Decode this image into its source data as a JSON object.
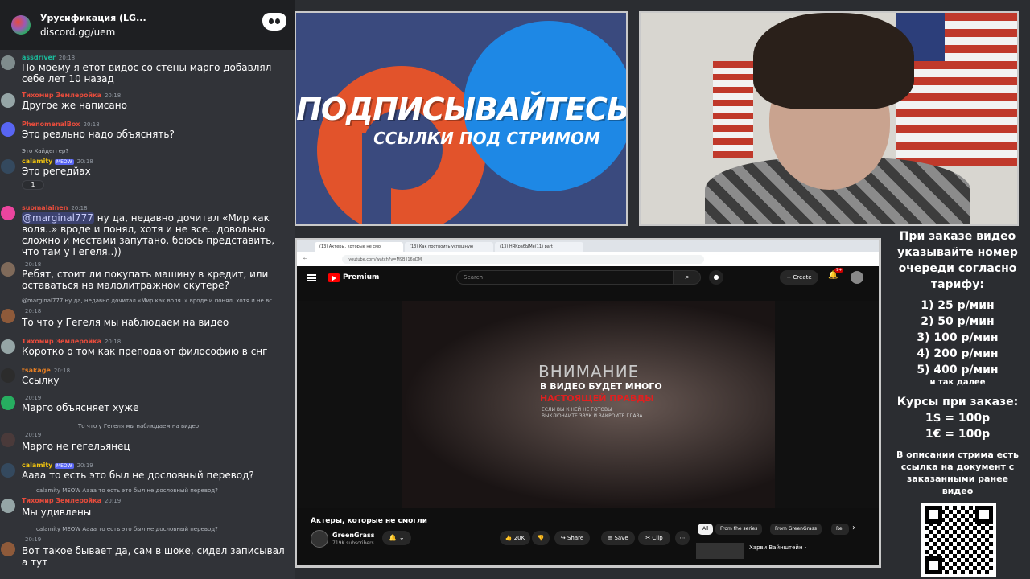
{
  "chat": {
    "server_title": "Урусификация (LG...",
    "invite": "discord.gg/uem",
    "messages": [
      {
        "name": "assdriver",
        "time": "20:18",
        "name_color": "#1abc9c",
        "text": "По-моему я етот видос со стены марго добавлял себе лет 10 назад"
      },
      {
        "name": "Тихомир Землеройка",
        "time": "20:18",
        "name_color": "#e74c3c",
        "text": "Другое же написано"
      },
      {
        "name": "PhenomenalBox",
        "time": "20:18",
        "name_color": "#e74c3c",
        "text": "Это реально надо объяснять?"
      },
      {
        "reply": "Это Хайдеггер?",
        "name": "calamity",
        "badge": "MEOW",
        "time": "20:18",
        "name_color": "#f1c40f",
        "text": "Это регедйах",
        "reaction_count": "1"
      },
      {
        "name": "suomalainen",
        "time": "20:18",
        "name_color": "#e74c3c",
        "mention": "@marginal777",
        "text": " ну да, недавно дочитал «Мир как воля..» вроде и понял, хотя и не все.. довольно сложно и местами запутано, боюсь представить, что там у Гегеля..))"
      },
      {
        "name": "",
        "time": "20:18",
        "name_color": "#e74c3c",
        "text": "Ребят, стоит ли покупать машину в кредит, или оставаться на малолитражном скутере?"
      },
      {
        "reply": "@marginal777 ну да, недавно дочитал «Мир как воля..» вроде и понял, хотя и не вс",
        "name": "",
        "time": "20:18",
        "name_color": "#e74c3c",
        "text": "То что у Гегеля мы наблюдаем на видео"
      },
      {
        "name": "Тихомир Землеройка",
        "time": "20:18",
        "name_color": "#e74c3c",
        "text": "Коротко о том как преподают философию в снг"
      },
      {
        "name": "tsakage",
        "time": "20:18",
        "name_color": "#e67e22",
        "text": "Ссылку"
      },
      {
        "name": "",
        "time": "20:19",
        "name_color": "#9b59b6",
        "text": "Марго объясняет хуже"
      },
      {
        "reply": "То что у Гегеля мы наблюдаем на видео",
        "name": "",
        "time": "20:19",
        "name_color": "#e74c3c",
        "text": "Марго не гегельянец"
      },
      {
        "name": "calamity",
        "badge": "MEOW",
        "time": "20:19",
        "name_color": "#f1c40f",
        "text": "Аааа то есть это был не дословный перевод?"
      },
      {
        "reply": "calamity MEOW Аааа то есть это был не дословный перевод?",
        "name": "Тихомир Землеройка",
        "time": "20:19",
        "name_color": "#e74c3c",
        "text": "Мы удивлены"
      },
      {
        "reply": "calamity MEOW Аааа то есть это был не дословный перевод?",
        "name": "",
        "time": "20:19",
        "name_color": "#e74c3c",
        "text": "Вот такое бывает да, сам в шоке, сидел записывал а тут"
      }
    ]
  },
  "promo": {
    "title": "ПОДПИСЫВАЙТЕСЬ",
    "subtitle": "ССЫЛКИ ПОД СТРИМОМ"
  },
  "browser": {
    "tabs": [
      "(13) Актеры, которые не смо",
      "(13) Как построить успешную",
      "(13) НЯКрабЫМе(11) part"
    ],
    "url": "youtube.com/watch?v=M9BIl16uDMl",
    "yt": {
      "brand": "Premium",
      "search_placeholder": "Search",
      "create_label": "Create",
      "notif_count": "9+"
    },
    "video": {
      "warning_title": "ВНИМАНИЕ",
      "warning_line2": "В ВИДЕО БУДЕТ МНОГО",
      "warning_line3": "НАСТОЯЩЕЙ ПРАВДЫ",
      "warning_small": "ЕСЛИ ВЫ К НЕЙ НЕ ГОТОВЫ\nВЫКЛЮЧАЙТЕ ЗВУК И ЗАКРОЙТЕ ГЛАЗА",
      "title": "Актеры, которые не смогли",
      "channel": "GreenGrass",
      "subs": "719K subscribers",
      "likes": "20K",
      "share": "Share",
      "save": "Save",
      "clip": "Clip"
    },
    "chips": [
      "All",
      "From the series",
      "From GreenGrass",
      "Re"
    ],
    "rec_title": "Харви Вайнштейн -"
  },
  "sidebar": {
    "order_text": "При заказе видео указывайте номер очереди согласно тарифу:",
    "tariffs": [
      "1) 25 р/мин",
      "2) 50 р/мин",
      "3) 100 р/мин",
      "4) 200 р/мин",
      "5) 400 р/мин"
    ],
    "etc": "и так далее",
    "rates_title": "Курсы при заказе:",
    "rates": [
      "1$ = 100р",
      "1€ = 100р"
    ],
    "description": "В описании стрима есть ссылка на документ с заказанными ранее видео"
  }
}
